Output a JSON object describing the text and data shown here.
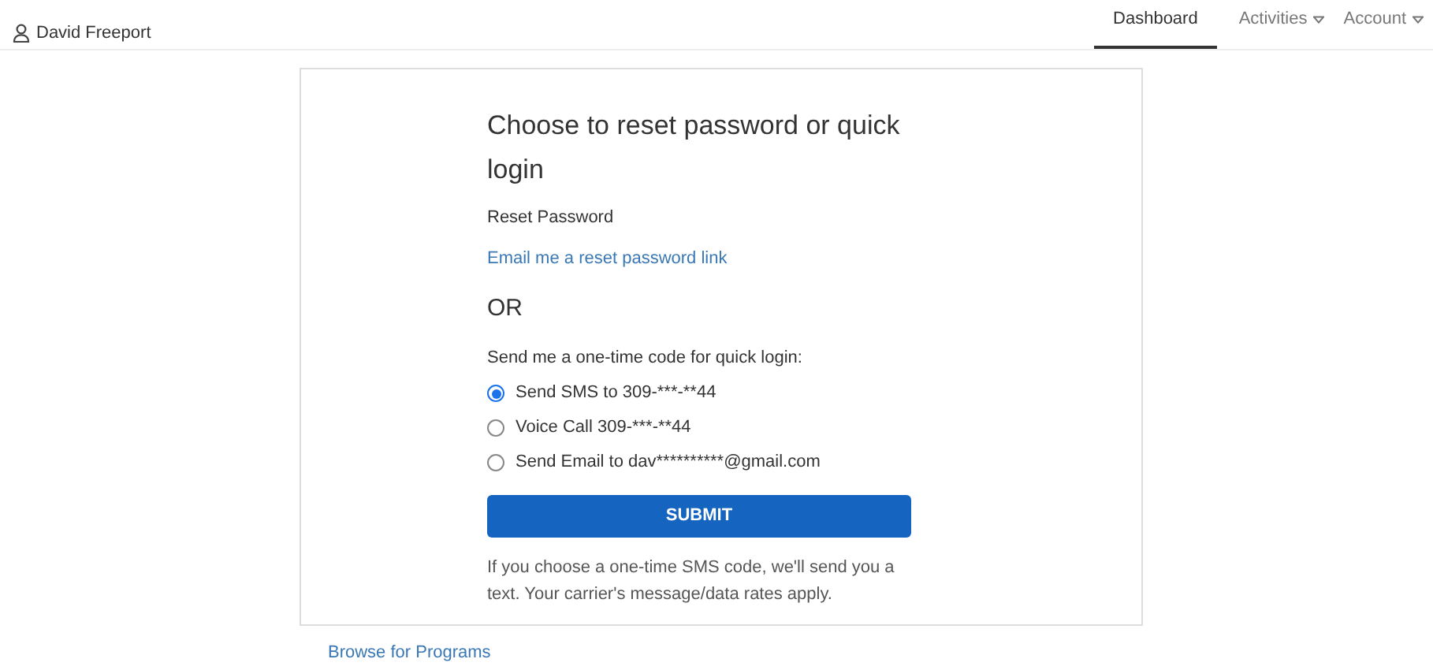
{
  "header": {
    "user": "David Freeport",
    "nav": [
      {
        "label": "Dashboard",
        "selected": true,
        "dropdown": false
      },
      {
        "label": "Activities",
        "selected": false,
        "dropdown": true
      },
      {
        "label": "Account",
        "selected": false,
        "dropdown": true
      }
    ]
  },
  "card": {
    "title": "Choose to reset password or quick login",
    "reset_label": "Reset Password",
    "reset_link": "Email me a reset password link",
    "or": "OR",
    "prompt": "Send me a one-time code for quick login:",
    "options": [
      {
        "label": "Send SMS to 309-***-**44",
        "selected": true
      },
      {
        "label": "Voice Call 309-***-**44",
        "selected": false
      },
      {
        "label": "Send Email to dav**********@gmail.com",
        "selected": false
      }
    ],
    "submit": "SUBMIT",
    "note": "If you choose a one-time SMS code, we'll send you a text. Your carrier's message/data rates apply."
  },
  "footer_link": "Browse for Programs"
}
